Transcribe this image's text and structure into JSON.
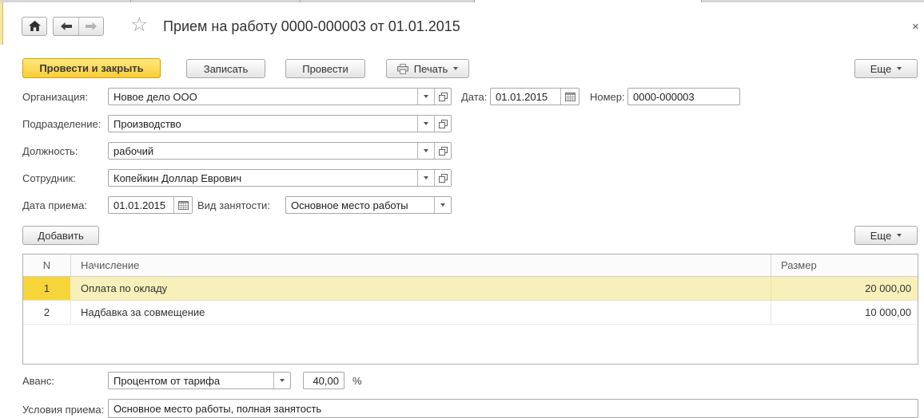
{
  "window": {
    "title": "Прием на работу 0000-000003 от 01.01.2015",
    "close_glyph": "×"
  },
  "toolbar": {
    "post_and_close": "Провести и закрыть",
    "save": "Записать",
    "post": "Провести",
    "print": "Печать",
    "more": "Еще"
  },
  "header_fields": {
    "organization": {
      "label": "Организация:",
      "value": "Новое дело ООО"
    },
    "doc_date": {
      "label": "Дата:",
      "value": "01.01.2015"
    },
    "doc_number": {
      "label": "Номер:",
      "value": "0000-000003"
    },
    "department": {
      "label": "Подразделение:",
      "value": "Производство"
    },
    "position": {
      "label": "Должность:",
      "value": "рабочий"
    },
    "employee": {
      "label": "Сотрудник:",
      "value": "Копейкин Доллар Еврович"
    },
    "hire_date": {
      "label": "Дата приема:",
      "value": "01.01.2015"
    },
    "employment_type": {
      "label": "Вид занятости:",
      "value": "Основное место работы"
    }
  },
  "accruals_table": {
    "add_button": "Добавить",
    "more_button": "Еще",
    "columns": {
      "num": "N",
      "accrual": "Начисление",
      "amount": "Размер"
    },
    "rows": [
      {
        "num": "1",
        "accrual": "Оплата по окладу",
        "amount": "20 000,00"
      },
      {
        "num": "2",
        "accrual": "Надбавка за совмещение",
        "amount": "10 000,00"
      }
    ]
  },
  "footer_fields": {
    "advance": {
      "label": "Аванс:",
      "value": "Процентом от тарифа",
      "percent": "40,00",
      "unit": "%"
    },
    "conditions": {
      "label": "Условия приема:",
      "value": "Основное место работы, полная занятость"
    }
  },
  "colors": {
    "accent_button": "#fbce3a",
    "selected_row": "#f8f0ba",
    "selected_row_num": "#f6d53a"
  }
}
